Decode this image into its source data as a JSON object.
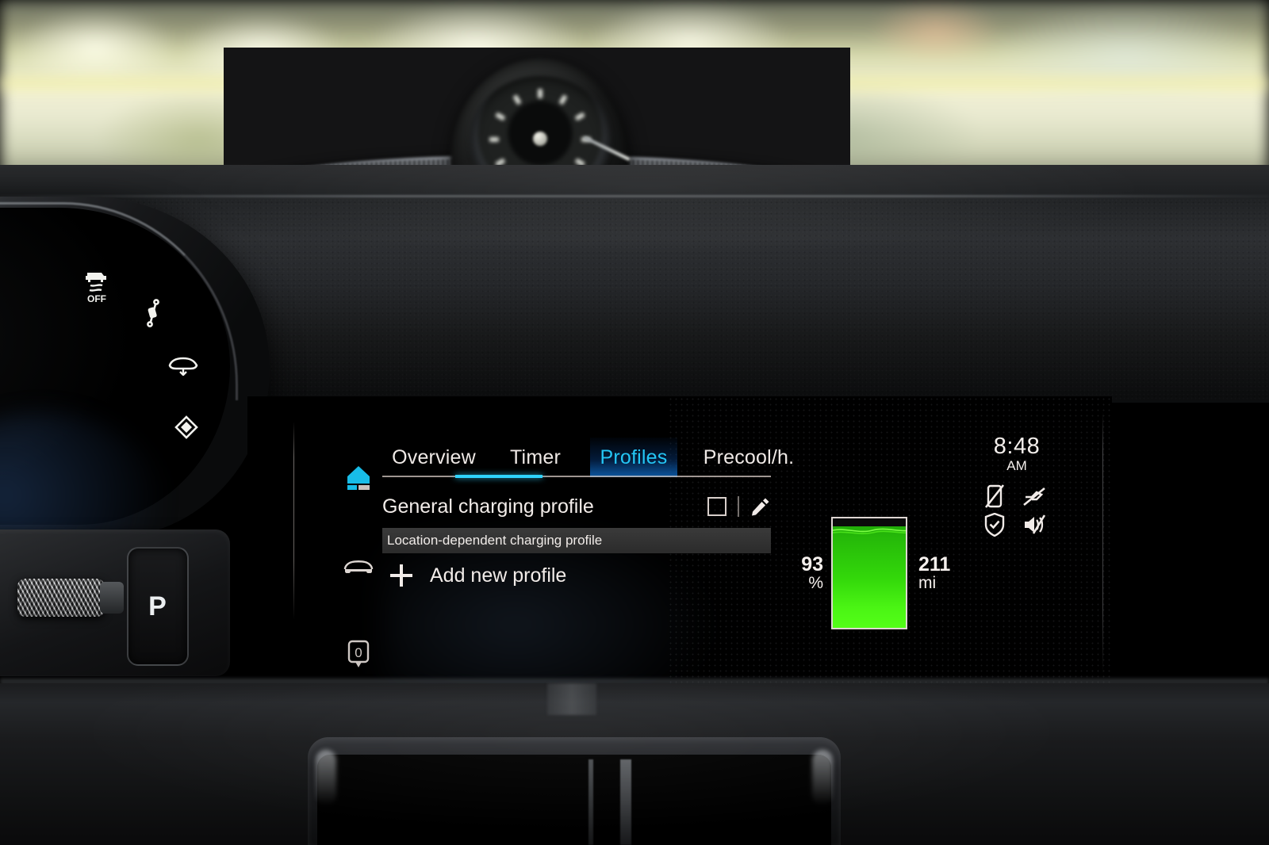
{
  "screen": {
    "tabs": [
      {
        "label": "Overview",
        "active": false
      },
      {
        "label": "Timer",
        "active": false
      },
      {
        "label": "Profiles",
        "active": true
      },
      {
        "label": "Precool/h.",
        "active": false
      }
    ],
    "sidebar": {
      "items": [
        {
          "name": "charging-station-icon",
          "label": "Charging",
          "active": true
        },
        {
          "name": "vehicle-icon",
          "label": "Vehicle",
          "active": false
        },
        {
          "name": "location-marker-icon",
          "label": "0",
          "active": false
        }
      ]
    },
    "rows": {
      "general_profile_label": "General charging profile",
      "checkbox_checked": false,
      "section_header_label": "Location-dependent charging profile",
      "add_profile_label": "Add new profile"
    },
    "status": {
      "clock_time": "8:48",
      "clock_meridiem": "AM",
      "icons": [
        {
          "name": "phone-off-icon",
          "label": "Phone disconnected"
        },
        {
          "name": "key-disconnected-icon",
          "label": "Key not detected"
        },
        {
          "name": "shield-check-icon",
          "label": "Security active"
        },
        {
          "name": "volume-muted-icon",
          "label": "Sound muted"
        }
      ]
    },
    "battery": {
      "percent_value": "93",
      "percent_unit": "%",
      "range_value": "211",
      "range_unit": "mi",
      "fill_percent": 93,
      "color_fill_top": "#1fa708",
      "color_fill_bottom": "#53ff18"
    },
    "colors": {
      "accent_cyan": "#24c6f5",
      "active_underline": "#2fd3ff",
      "text_primary": "#f2ece9"
    }
  },
  "cluster": {
    "telltales": [
      {
        "name": "psm-off-icon",
        "label": "OFF"
      },
      {
        "name": "damper-icon",
        "label": "Shock absorber"
      },
      {
        "name": "lowered-suspension-icon",
        "label": "Lowered suspension"
      },
      {
        "name": "sport-mode-icon",
        "label": "Sport mode"
      }
    ]
  },
  "gear_selector": {
    "park_label": "P"
  }
}
